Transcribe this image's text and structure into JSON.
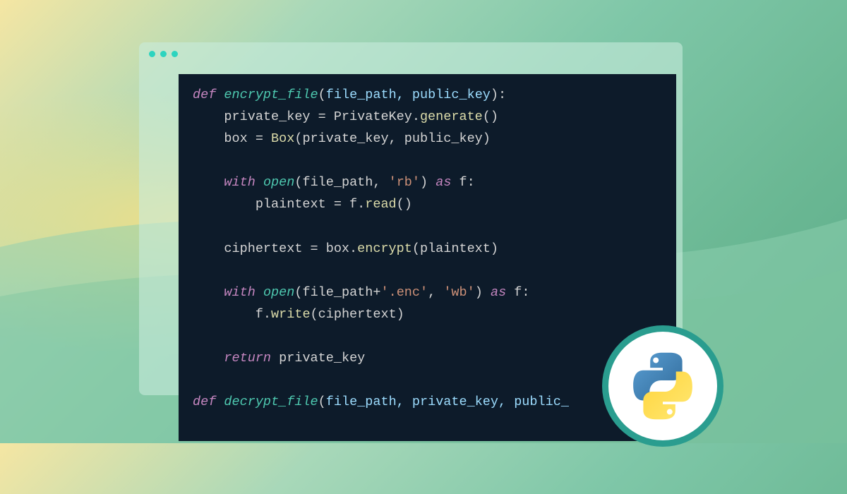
{
  "code": {
    "lines": [
      {
        "segments": [
          {
            "t": "def ",
            "c": "kw"
          },
          {
            "t": "encrypt_file",
            "c": "fn"
          },
          {
            "t": "(",
            "c": "punc"
          },
          {
            "t": "file_path, public_key",
            "c": "param"
          },
          {
            "t": "):",
            "c": "punc"
          }
        ]
      },
      {
        "segments": [
          {
            "t": "    private_key = PrivateKey.",
            "c": "ident"
          },
          {
            "t": "generate",
            "c": "call"
          },
          {
            "t": "()",
            "c": "punc"
          }
        ]
      },
      {
        "segments": [
          {
            "t": "    box = ",
            "c": "ident"
          },
          {
            "t": "Box",
            "c": "call"
          },
          {
            "t": "(private_key, public_key)",
            "c": "ident"
          }
        ]
      },
      {
        "segments": [
          {
            "t": " ",
            "c": "ident"
          }
        ]
      },
      {
        "segments": [
          {
            "t": "    ",
            "c": "ident"
          },
          {
            "t": "with ",
            "c": "kw"
          },
          {
            "t": "open",
            "c": "fn"
          },
          {
            "t": "(file_path, ",
            "c": "ident"
          },
          {
            "t": "'rb'",
            "c": "str"
          },
          {
            "t": ") ",
            "c": "ident"
          },
          {
            "t": "as",
            "c": "kw"
          },
          {
            "t": " f:",
            "c": "ident"
          }
        ]
      },
      {
        "segments": [
          {
            "t": "        plaintext = f.",
            "c": "ident"
          },
          {
            "t": "read",
            "c": "call"
          },
          {
            "t": "()",
            "c": "punc"
          }
        ]
      },
      {
        "segments": [
          {
            "t": " ",
            "c": "ident"
          }
        ]
      },
      {
        "segments": [
          {
            "t": "    ciphertext = box.",
            "c": "ident"
          },
          {
            "t": "encrypt",
            "c": "call"
          },
          {
            "t": "(plaintext)",
            "c": "ident"
          }
        ]
      },
      {
        "segments": [
          {
            "t": " ",
            "c": "ident"
          }
        ]
      },
      {
        "segments": [
          {
            "t": "    ",
            "c": "ident"
          },
          {
            "t": "with ",
            "c": "kw"
          },
          {
            "t": "open",
            "c": "fn"
          },
          {
            "t": "(file_path+",
            "c": "ident"
          },
          {
            "t": "'.enc'",
            "c": "str"
          },
          {
            "t": ", ",
            "c": "ident"
          },
          {
            "t": "'wb'",
            "c": "str"
          },
          {
            "t": ") ",
            "c": "ident"
          },
          {
            "t": "as",
            "c": "kw"
          },
          {
            "t": " f:",
            "c": "ident"
          }
        ]
      },
      {
        "segments": [
          {
            "t": "        f.",
            "c": "ident"
          },
          {
            "t": "write",
            "c": "call"
          },
          {
            "t": "(ciphertext)",
            "c": "ident"
          }
        ]
      },
      {
        "segments": [
          {
            "t": " ",
            "c": "ident"
          }
        ]
      },
      {
        "segments": [
          {
            "t": "    ",
            "c": "ident"
          },
          {
            "t": "return",
            "c": "kw"
          },
          {
            "t": " private_key",
            "c": "ident"
          }
        ]
      },
      {
        "segments": [
          {
            "t": " ",
            "c": "ident"
          }
        ]
      },
      {
        "segments": [
          {
            "t": "def ",
            "c": "kw"
          },
          {
            "t": "decrypt_file",
            "c": "fn"
          },
          {
            "t": "(",
            "c": "punc"
          },
          {
            "t": "file_path, private_key, public_",
            "c": "param"
          }
        ]
      }
    ]
  },
  "badge": {
    "language": "Python"
  }
}
